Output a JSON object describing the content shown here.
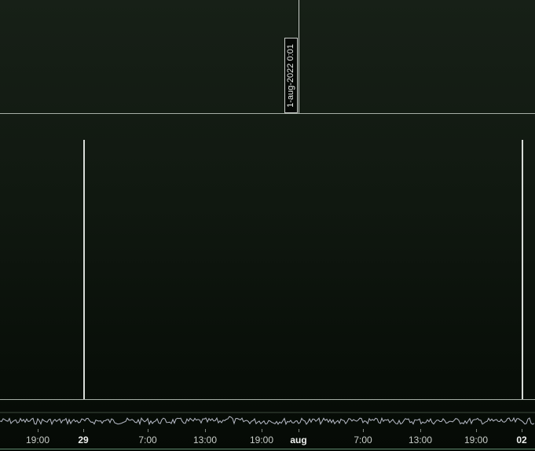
{
  "cursor": {
    "date_label": "1-aug-2022 0:01"
  },
  "time_axis": {
    "ticks": [
      {
        "label": "19:00",
        "major": false
      },
      {
        "label": "29",
        "major": true
      },
      {
        "label": "7:00",
        "major": false
      },
      {
        "label": "13:00",
        "major": false
      },
      {
        "label": "19:00",
        "major": false
      },
      {
        "label": "aug",
        "major": true
      },
      {
        "label": "7:00",
        "major": false
      },
      {
        "label": "13:00",
        "major": false
      },
      {
        "label": "19:00",
        "major": false
      },
      {
        "label": "02",
        "major": true
      }
    ]
  },
  "colors": {
    "background_top": "#172017",
    "background_bottom": "#050a05",
    "line": "#d8dcd8",
    "axis_accent": "#5e8a6e"
  }
}
